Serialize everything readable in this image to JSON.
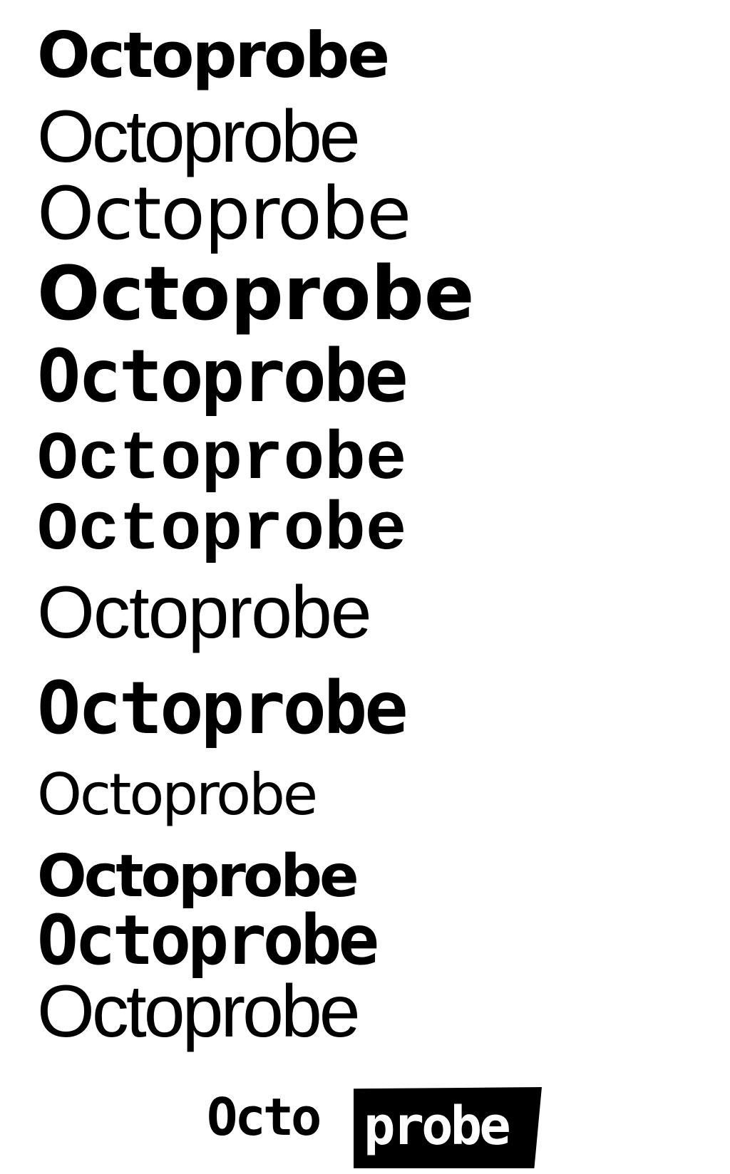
{
  "samples": [
    "Octoprobe",
    "Octoprobe",
    "Octoprobe",
    "Octoprobe",
    "Octoprobe",
    "Octoprobe",
    "Octoprobe",
    "Octoprobe",
    "Octoprobe",
    "Octoprobe",
    "Octoprobe",
    "Octoprobe",
    "Octoprobe"
  ],
  "logo": {
    "part1": "Octo",
    "part2": "probe"
  },
  "colors": {
    "text": "#000000",
    "background": "#ffffff",
    "logo_box": "#000000",
    "logo_box_text": "#ffffff"
  }
}
